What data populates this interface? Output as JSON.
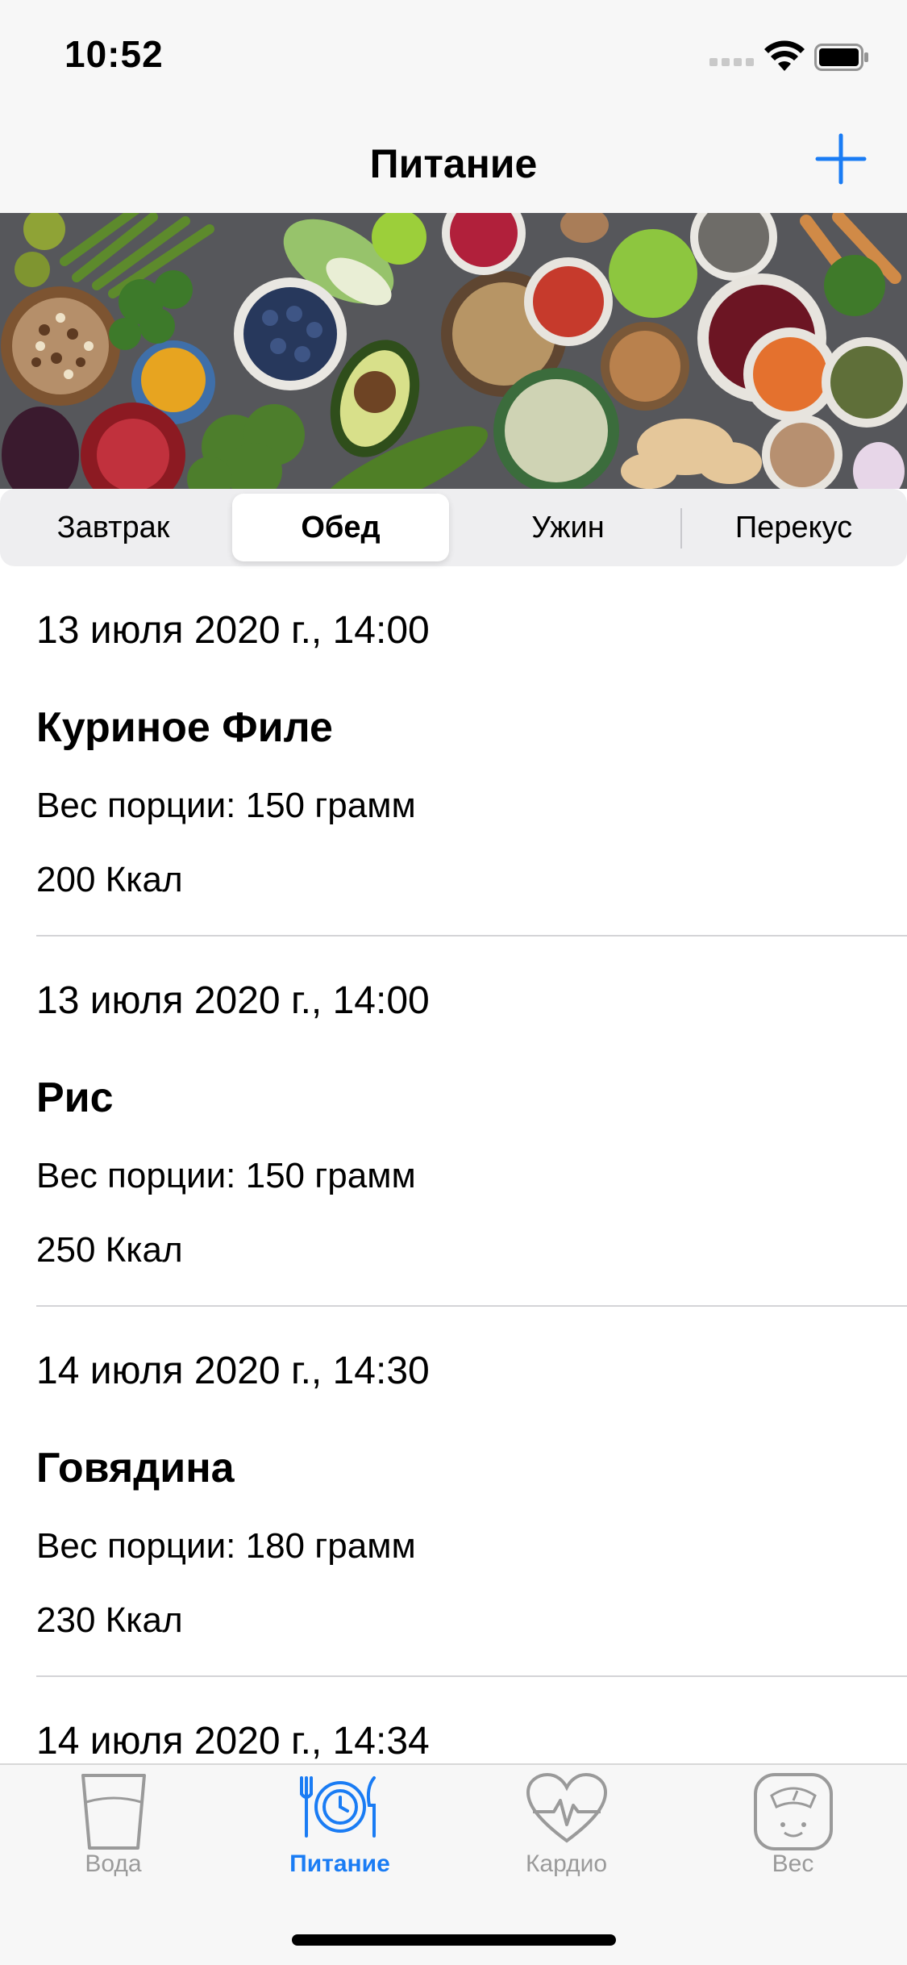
{
  "status_bar": {
    "time": "10:52"
  },
  "nav": {
    "title": "Питание",
    "add_icon": "plus-icon"
  },
  "colors": {
    "accent": "#1a7cf4",
    "inactive": "#9a9a9a",
    "separator": "#d4d4d7"
  },
  "hero": {
    "image": "vegetables-and-grains-photo"
  },
  "segments": [
    {
      "label": "Завтрак",
      "selected": false
    },
    {
      "label": "Обед",
      "selected": true
    },
    {
      "label": "Ужин",
      "selected": false
    },
    {
      "label": "Перекус",
      "selected": false
    }
  ],
  "entries": [
    {
      "date": "13 июля 2020 г., 14:00",
      "name": "Куриное Филе",
      "weight": "Вес порции: 150 грамм",
      "kcal": "200 Ккал"
    },
    {
      "date": "13 июля 2020 г., 14:00",
      "name": "Рис",
      "weight": "Вес порции: 150 грамм",
      "kcal": "250 Ккал"
    },
    {
      "date": "14 июля 2020 г., 14:30",
      "name": "Говядина",
      "weight": "Вес порции: 180 грамм",
      "kcal": "230 Ккал"
    },
    {
      "date": "14 июля 2020 г., 14:34",
      "name": "",
      "weight": "",
      "kcal": ""
    }
  ],
  "tabs": [
    {
      "label": "Вода",
      "icon": "water-glass-icon",
      "active": false
    },
    {
      "label": "Питание",
      "icon": "plate-clock-icon",
      "active": true
    },
    {
      "label": "Кардио",
      "icon": "heart-pulse-icon",
      "active": false
    },
    {
      "label": "Вес",
      "icon": "scale-icon",
      "active": false
    }
  ]
}
